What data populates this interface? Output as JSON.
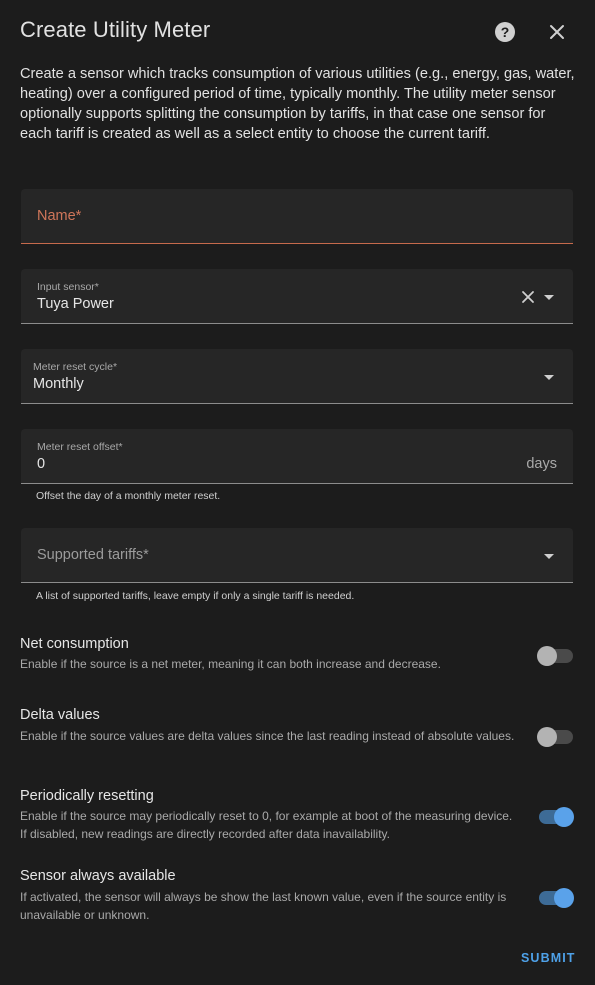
{
  "dialog": {
    "title": "Create Utility Meter",
    "description": "Create a sensor which tracks consumption of various utilities (e.g., energy, gas, water, heating) over a configured period of time, typically monthly. The utility meter sensor optionally supports splitting the consumption by tariffs, in that case one sensor for each tariff is created as well as a select entity to choose the current tariff."
  },
  "form": {
    "name": {
      "placeholder": "Name*",
      "value": ""
    },
    "input_sensor": {
      "label": "Input sensor*",
      "value": "Tuya Power"
    },
    "reset_cycle": {
      "label": "Meter reset cycle*",
      "value": "Monthly"
    },
    "reset_offset": {
      "label": "Meter reset offset*",
      "value": "0",
      "suffix": "days",
      "helper": "Offset the day of a monthly meter reset."
    },
    "tariffs": {
      "placeholder": "Supported tariffs*",
      "helper": "A list of supported tariffs, leave empty if only a single tariff is needed."
    }
  },
  "toggles": [
    {
      "title": "Net consumption",
      "description": "Enable if the source is a net meter, meaning it can both increase and decrease.",
      "on": false
    },
    {
      "title": "Delta values",
      "description": "Enable if the source values are delta values since the last reading instead of absolute values.",
      "on": false
    },
    {
      "title": "Periodically resetting",
      "description": "Enable if the source may periodically reset to 0, for example at boot of the measuring device. If disabled, new readings are directly recorded after data inavailability.",
      "on": true
    },
    {
      "title": "Sensor always available",
      "description": "If activated, the sensor will always be show the last known value, even if the source entity is unavailable or unknown.",
      "on": true
    }
  ],
  "actions": {
    "submit_label": "SUBMIT"
  },
  "colors": {
    "background": "#1c1c1c",
    "field_bg": "#262626",
    "error": "#d0765a",
    "accent": "#4ea1e8",
    "toggle_on": "#5aa2ea"
  },
  "icons": {
    "help": "help-circle-icon",
    "close": "close-icon",
    "clear": "clear-icon",
    "dropdown": "chevron-down-icon"
  }
}
